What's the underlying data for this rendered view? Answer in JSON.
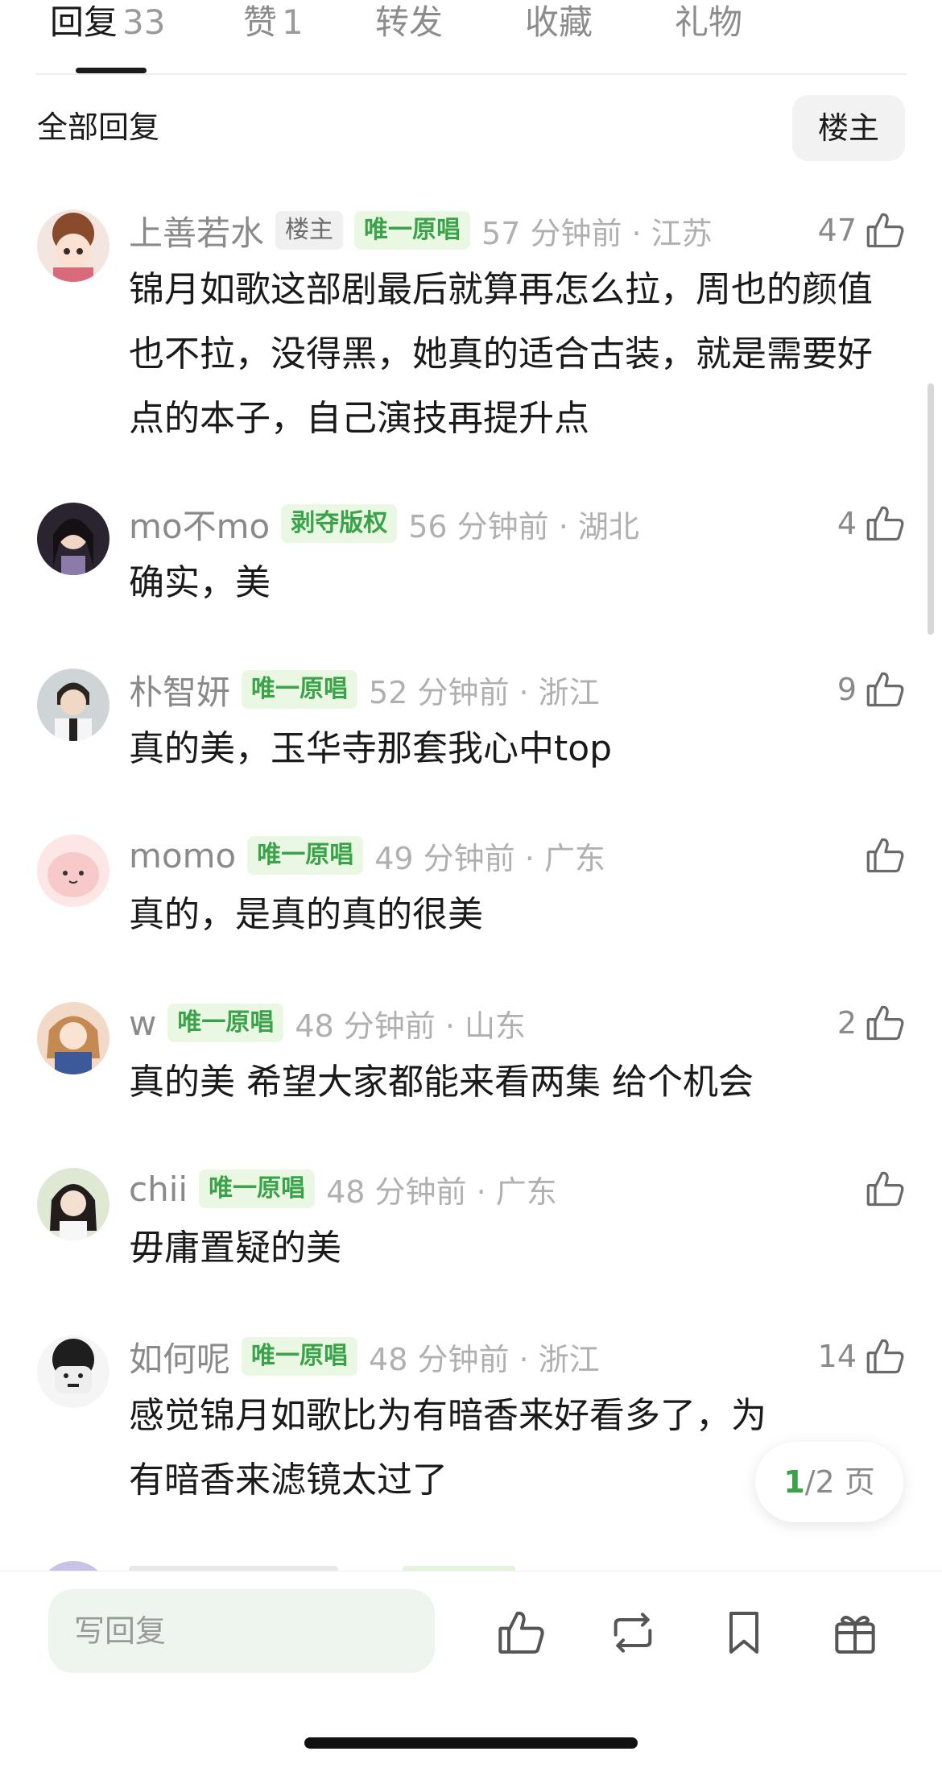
{
  "tabs": [
    {
      "label": "回复",
      "count": "33"
    },
    {
      "label": "赞",
      "count": "1"
    },
    {
      "label": "转发",
      "count": ""
    },
    {
      "label": "收藏",
      "count": ""
    },
    {
      "label": "礼物",
      "count": ""
    }
  ],
  "section": {
    "title": "全部回复",
    "filter_button": "楼主"
  },
  "comments": [
    {
      "username": "上善若水",
      "badges": [
        "楼主",
        "唯一原唱"
      ],
      "time": "57 分钟前 · 江苏",
      "likes": "47",
      "text": "锦月如歌这部剧最后就算再怎么拉，周也的颜值也不拉，没得黑，她真的适合古装，就是需要好点的本子，自己演技再提升点"
    },
    {
      "username": "mo不mo",
      "badges": [
        "剥夺版权"
      ],
      "time": "56 分钟前 · 湖北",
      "likes": "4",
      "text": "确实，美"
    },
    {
      "username": "朴智妍",
      "badges": [
        "唯一原唱"
      ],
      "time": "52 分钟前 · 浙江",
      "likes": "9",
      "text": "真的美，玉华寺那套我心中top"
    },
    {
      "username": "momo",
      "badges": [
        "唯一原唱"
      ],
      "time": "49 分钟前 · 广东",
      "likes": "",
      "text": "真的，是真的真的很美"
    },
    {
      "username": "w",
      "badges": [
        "唯一原唱"
      ],
      "time": "48 分钟前 · 山东",
      "likes": "2",
      "text": "真的美 希望大家都能来看两集 给个机会"
    },
    {
      "username": "chii",
      "badges": [
        "唯一原唱"
      ],
      "time": "48 分钟前 · 广东",
      "likes": "",
      "text": "毋庸置疑的美"
    },
    {
      "username": "如何呢",
      "badges": [
        "唯一原唱"
      ],
      "time": "48 分钟前 · 浙江",
      "likes": "14",
      "text": "感觉锦月如歌比为有暗香来好看多了，为有暗香来滤镜太过了"
    }
  ],
  "pagination": {
    "current": "1",
    "rest": "/2 页"
  },
  "bottom_bar": {
    "reply_placeholder": "写回复",
    "icons": [
      "like-icon",
      "repost-icon",
      "bookmark-icon",
      "gift-icon"
    ]
  },
  "colors": {
    "accent_green": "#3aa34a",
    "badge_green_bg": "#eaf8e3"
  }
}
